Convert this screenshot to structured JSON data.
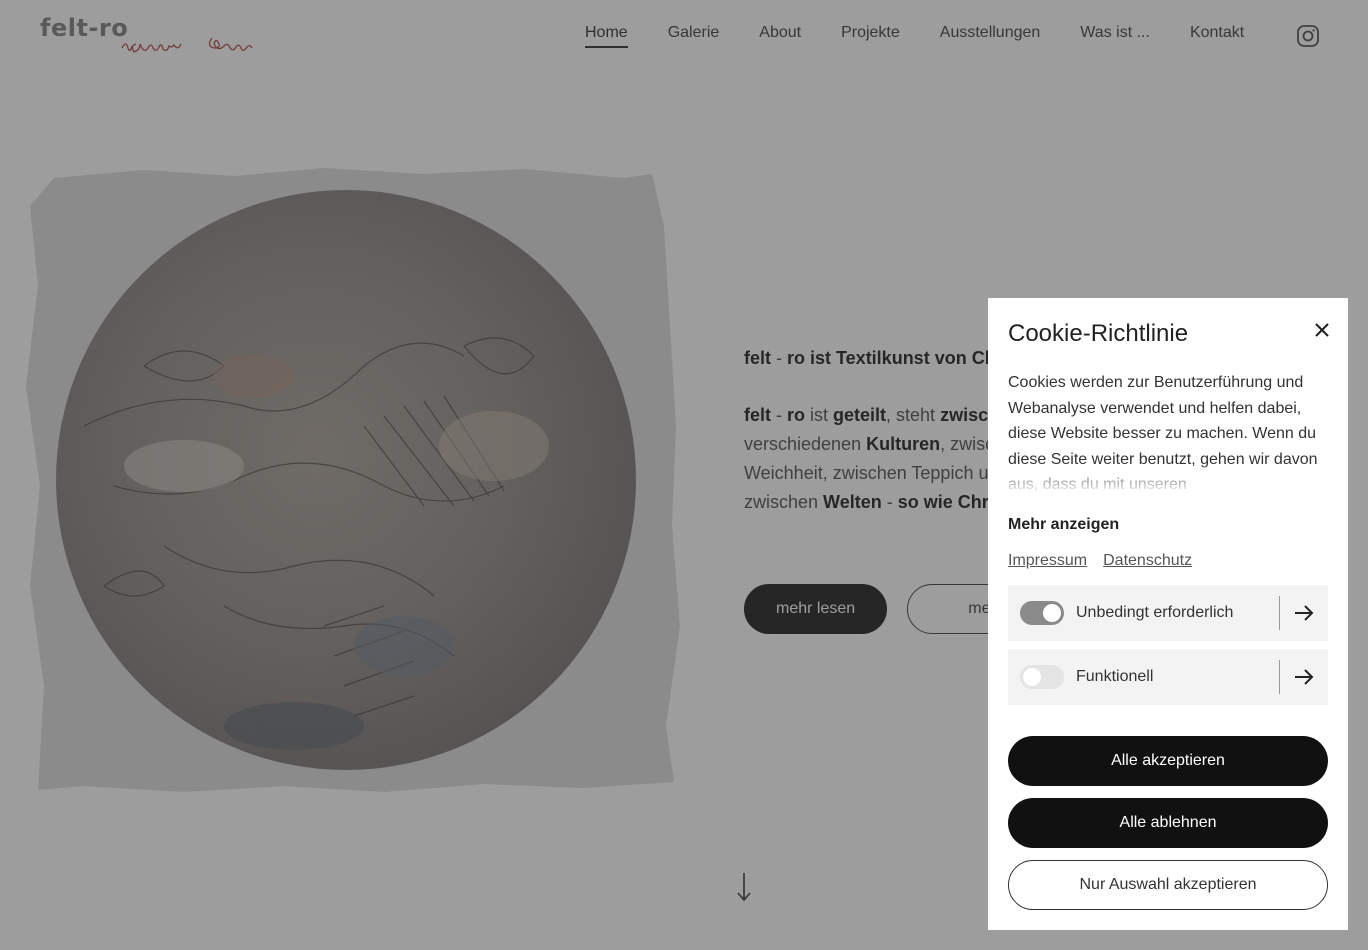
{
  "header": {
    "logo_text": "felt-ro",
    "nav": [
      {
        "label": "Home",
        "active": true
      },
      {
        "label": "Galerie"
      },
      {
        "label": "About"
      },
      {
        "label": "Projekte"
      },
      {
        "label": "Ausstellungen"
      },
      {
        "label": "Was ist ..."
      },
      {
        "label": "Kontakt"
      }
    ],
    "social_icon": "instagram-icon"
  },
  "hero": {
    "intro": {
      "b1": "felt",
      "t1": " - ",
      "b2": "ro ist Textilkunst von Chri"
    },
    "para": {
      "b1": "felt",
      "t1": " - ",
      "b2": "ro",
      "t2": " ist ",
      "b3": "geteilt",
      "t3": ", steht ",
      "b4": "zwisch",
      "t4": "verschiedenen ",
      "b5": "Kulturen",
      "t5": ", zwisch",
      "t6": "Weichheit, zwischen Teppich u",
      "t7": "zwischen ",
      "b6": "Welten",
      "t8": " - ",
      "b7": "so wie Chris"
    },
    "btn_read_more": "mehr lesen",
    "btn_see_more": "mehr se",
    "scroll_icon": "arrow-down-icon"
  },
  "cookie": {
    "title": "Cookie-Richtlinie",
    "description": "Cookies werden zur Benutzerführung und Webanalyse verwendet und helfen dabei, diese Website besser zu machen. Wenn du diese Seite weiter benutzt, gehen wir davon aus, dass du mit unseren",
    "more": "Mehr anzeigen",
    "links": [
      "Impressum",
      "Datenschutz"
    ],
    "categories": [
      {
        "label": "Unbedingt erforderlich",
        "enabled": true
      },
      {
        "label": "Funktionell",
        "enabled": false
      }
    ],
    "accept_all": "Alle akzeptieren",
    "reject_all": "Alle ablehnen",
    "accept_selection": "Nur Auswahl akzeptieren"
  },
  "colors": {
    "overlay": "#3c3c3c",
    "primary_button": "#111111",
    "logo_signature": "#b03a3a"
  }
}
